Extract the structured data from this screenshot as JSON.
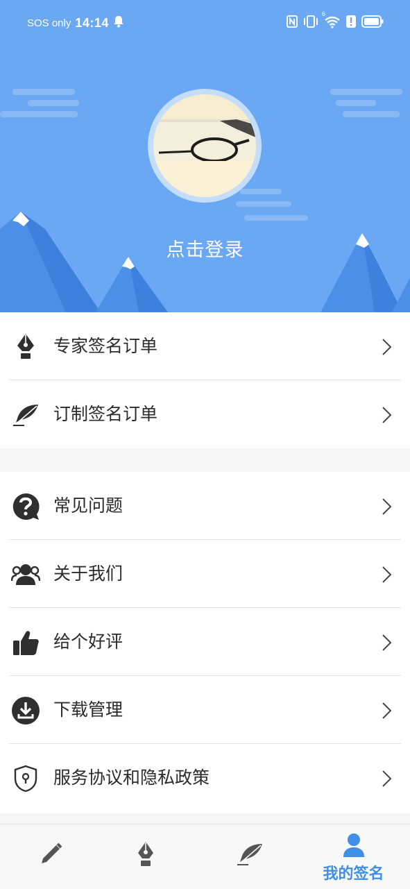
{
  "status_bar": {
    "carrier": "SOS only",
    "time": "14:14",
    "network_badge": "6",
    "icons": [
      "bell-icon",
      "nfc-icon",
      "vibrate-icon",
      "wifi-icon",
      "alert-icon",
      "battery-icon"
    ]
  },
  "profile": {
    "login_label": "点击登录"
  },
  "menu_group_1": [
    {
      "label": "专家签名订单",
      "icon": "fountain-pen-icon"
    },
    {
      "label": "订制签名订单",
      "icon": "feather-icon"
    }
  ],
  "menu_group_2": [
    {
      "label": "常见问题",
      "icon": "question-icon"
    },
    {
      "label": "关于我们",
      "icon": "users-icon"
    },
    {
      "label": "给个好评",
      "icon": "thumbs-up-icon"
    },
    {
      "label": "下载管理",
      "icon": "download-icon"
    },
    {
      "label": "服务协议和隐私政策",
      "icon": "shield-icon"
    }
  ],
  "bottom_nav": [
    {
      "icon": "pencil-icon",
      "label": ""
    },
    {
      "icon": "fountain-pen-icon",
      "label": ""
    },
    {
      "icon": "feather-icon",
      "label": ""
    },
    {
      "icon": "person-icon",
      "label": "我的签名",
      "active": true
    }
  ],
  "colors": {
    "header_bg": "#6aa8f3",
    "accent": "#3f8fe8",
    "icon_dark": "#2f2f2f",
    "nav_icon": "#555555"
  }
}
